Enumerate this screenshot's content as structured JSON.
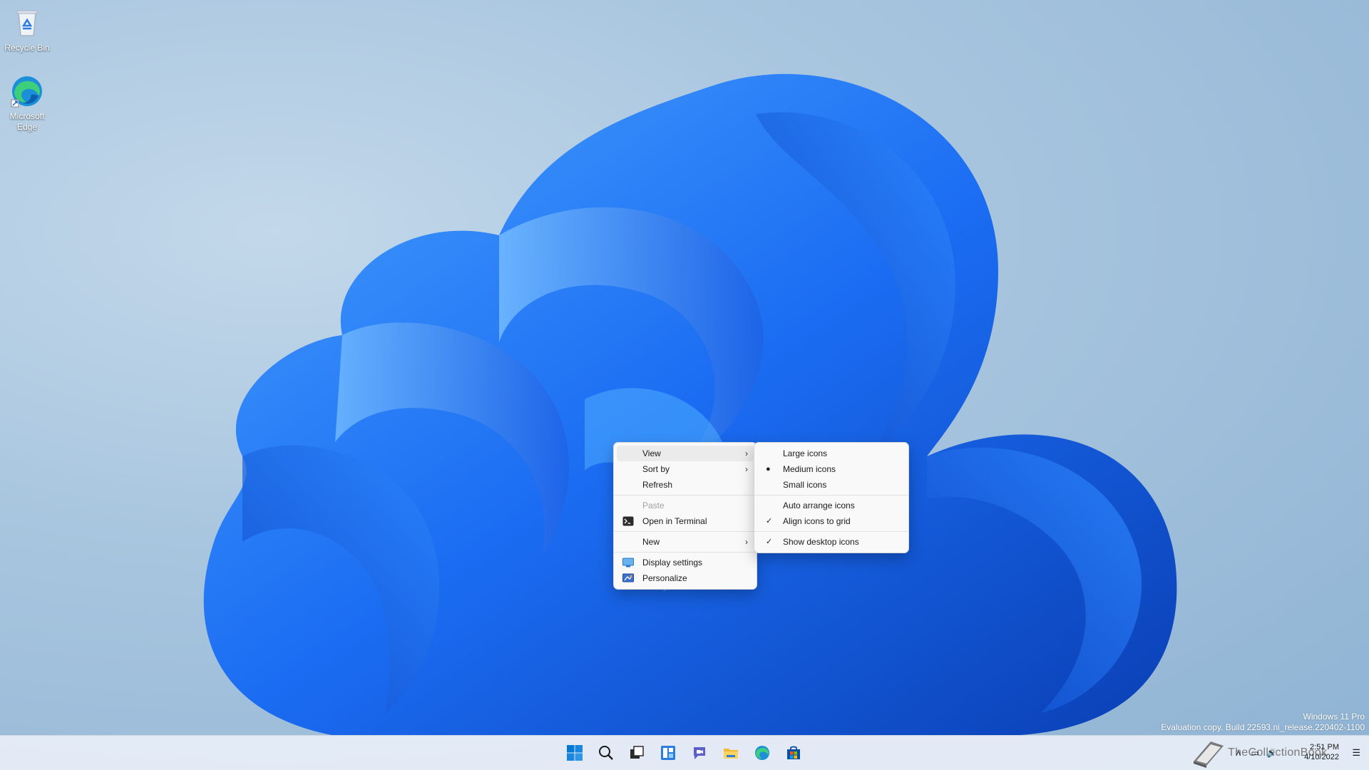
{
  "desktop": {
    "icons": [
      {
        "label": "Recycle Bin",
        "icon": "recycle-bin-icon"
      },
      {
        "label": "Microsoft Edge",
        "icon": "edge-icon"
      }
    ]
  },
  "context_menu": {
    "items": [
      {
        "label": "View",
        "submenu": true,
        "state": "hover"
      },
      {
        "label": "Sort by",
        "submenu": true
      },
      {
        "label": "Refresh"
      },
      {
        "label": "Paste",
        "state": "disabled"
      },
      {
        "label": "Open in Terminal",
        "icon": "terminal-icon"
      },
      {
        "label": "New",
        "submenu": true
      },
      {
        "label": "Display settings",
        "icon": "display-icon"
      },
      {
        "label": "Personalize",
        "icon": "personalize-icon"
      }
    ]
  },
  "view_submenu": {
    "items": [
      {
        "label": "Large icons"
      },
      {
        "label": "Medium icons",
        "mark": "●"
      },
      {
        "label": "Small icons"
      },
      {
        "label": "Auto arrange icons"
      },
      {
        "label": "Align icons to grid",
        "mark": "✓"
      },
      {
        "label": "Show desktop icons",
        "mark": "✓"
      }
    ]
  },
  "watermark": {
    "line1": "Windows 11 Pro",
    "line2": "Evaluation copy. Build 22593.ni_release.220402-1100"
  },
  "taskbar": {
    "apps": [
      "start-icon",
      "search-icon",
      "task-view-icon",
      "widgets-icon",
      "chat-icon",
      "file-explorer-icon",
      "edge-icon",
      "store-icon"
    ],
    "overlay_text": "TheCollectionBook",
    "clock": {
      "time": "2:51 PM",
      "date": "4/10/2022"
    }
  },
  "colors": {
    "accent": "#0067c0",
    "bloom": "#1a6cf0"
  }
}
